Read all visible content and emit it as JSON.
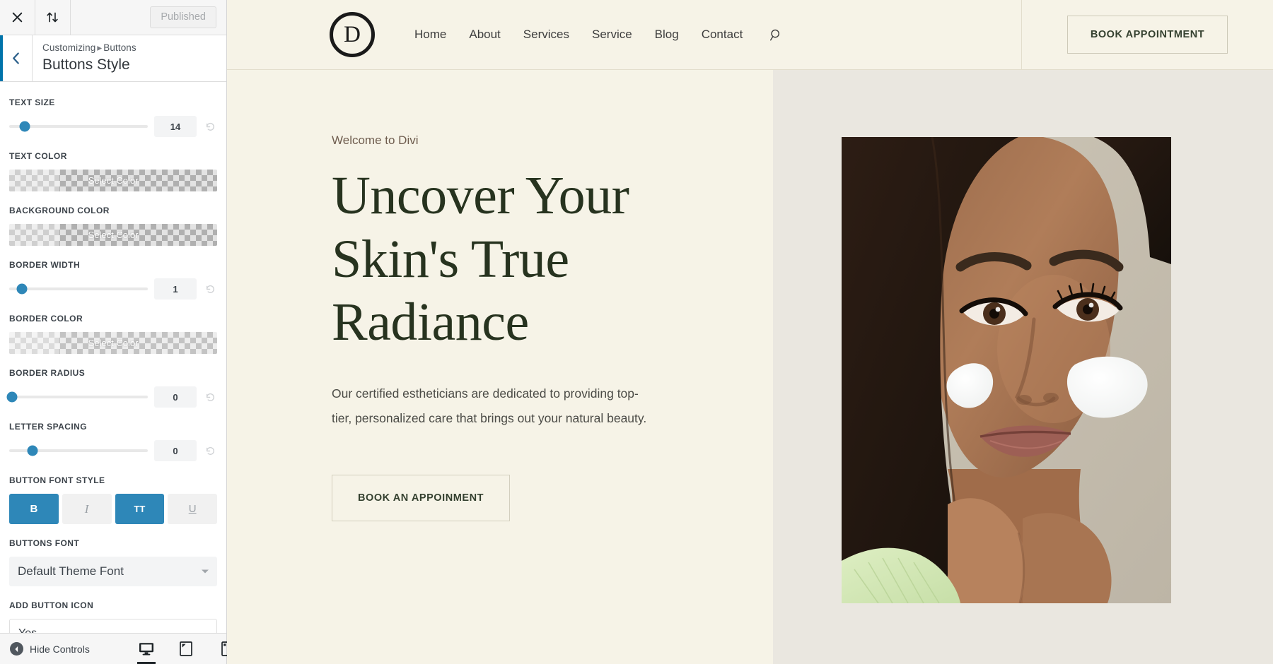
{
  "customizer": {
    "topbar": {
      "close_icon": "close-icon",
      "swap_icon": "reorder-updown-icon",
      "status_label": "Published"
    },
    "header": {
      "back_icon": "chevron-left-icon",
      "breadcrumb_root": "Customizing",
      "breadcrumb_separator": "▸",
      "breadcrumb_current": "Buttons",
      "panel_title": "Buttons Style"
    },
    "controls": [
      {
        "type": "slider",
        "label": "TEXT SIZE",
        "value": "14",
        "knob_pct": 11
      },
      {
        "type": "color",
        "label": "TEXT COLOR",
        "value": "Select Color"
      },
      {
        "type": "color",
        "label": "BACKGROUND COLOR",
        "value": "Select Color"
      },
      {
        "type": "slider",
        "label": "BORDER WIDTH",
        "value": "1",
        "knob_pct": 9
      },
      {
        "type": "color",
        "label": "BORDER COLOR",
        "value": "Select Color"
      },
      {
        "type": "slider",
        "label": "BORDER RADIUS",
        "value": "0",
        "knob_pct": 2
      },
      {
        "type": "slider",
        "label": "LETTER SPACING",
        "value": "0",
        "knob_pct": 17
      }
    ],
    "font_style": {
      "label": "BUTTON FONT STYLE",
      "buttons": [
        {
          "name": "bold",
          "glyph": "B",
          "active": true
        },
        {
          "name": "italic",
          "glyph": "I",
          "active": false
        },
        {
          "name": "uppercase",
          "glyph": "TT",
          "active": true
        },
        {
          "name": "underline",
          "glyph": "U",
          "active": false
        }
      ]
    },
    "buttons_font": {
      "label": "BUTTONS FONT",
      "value": "Default Theme Font"
    },
    "add_button_icon": {
      "label": "ADD BUTTON ICON",
      "value": "Yes"
    },
    "bottom": {
      "hide_controls_label": "Hide Controls",
      "devices": [
        {
          "name": "desktop",
          "icon": "desktop-icon",
          "active": true
        },
        {
          "name": "tablet",
          "icon": "tablet-icon",
          "active": false
        },
        {
          "name": "mobile",
          "icon": "mobile-icon",
          "active": false
        }
      ]
    },
    "accent_color": "#0073aa",
    "active_toggle_color": "#2e87b8"
  },
  "site": {
    "logo_letter": "D",
    "nav": [
      {
        "label": "Home"
      },
      {
        "label": "About"
      },
      {
        "label": "Services"
      },
      {
        "label": "Service"
      },
      {
        "label": "Blog"
      },
      {
        "label": "Contact"
      }
    ],
    "search_icon": "search-icon",
    "header_cta": "BOOK APPOINTMENT",
    "hero": {
      "eyebrow": "Welcome to Divi",
      "heading_line1": "Uncover Your",
      "heading_line2": "Skin's True",
      "heading_line3": "Radiance",
      "paragraph": "Our certified estheticians are dedicated to providing top-tier, personalized care that brings out your natural beauty.",
      "cta": "BOOK AN APPOINMENT",
      "image_alt": "portrait-woman-face-cream"
    },
    "colors": {
      "page_bg": "#f6f3e7",
      "panel_bg": "#eae7e0",
      "heading": "#27331f",
      "eyebrow": "#6e5c4e"
    }
  }
}
